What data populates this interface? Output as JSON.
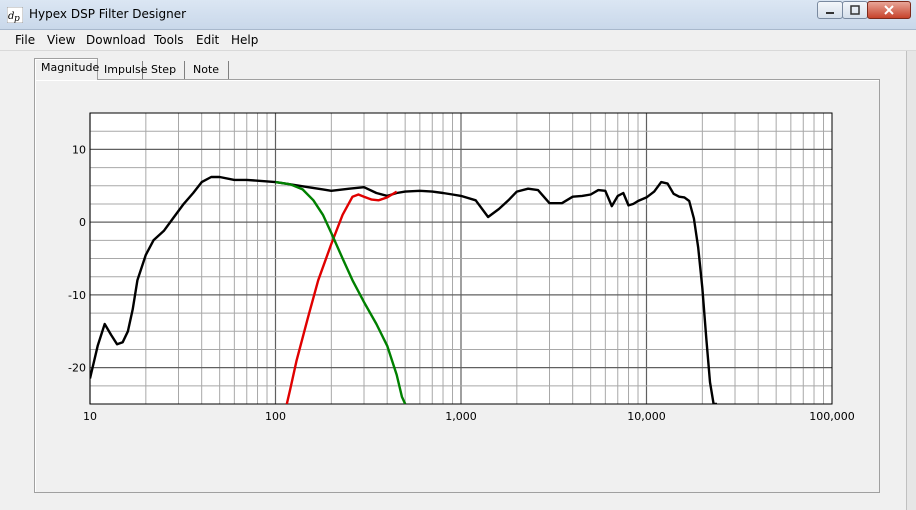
{
  "window": {
    "title": "Hypex DSP Filter Designer"
  },
  "menu": [
    "File",
    "View",
    "Download",
    "Tools",
    "Edit",
    "Help"
  ],
  "tabs": [
    {
      "label": "Magnitude",
      "active": true
    },
    {
      "label": "Impulse",
      "active": false
    },
    {
      "label": "Step",
      "active": false
    },
    {
      "label": "Note",
      "active": false
    }
  ],
  "chart_data": {
    "type": "line",
    "xscale": "log",
    "xlim": [
      10,
      100000
    ],
    "ylim": [
      -25,
      15
    ],
    "grid": true,
    "ytick_labels": [
      "10",
      "0",
      "-10",
      "-20"
    ],
    "ytick_values": [
      10,
      0,
      -10,
      -20
    ],
    "xtick_labels": [
      "10",
      "100",
      "1,000",
      "10,000",
      "100,000"
    ],
    "xtick_values": [
      10,
      100,
      1000,
      10000,
      100000
    ],
    "series": [
      {
        "color": "#000000",
        "x": [
          10,
          11,
          12,
          13,
          14,
          15,
          16,
          17,
          18,
          20,
          22,
          25,
          28,
          32,
          36,
          40,
          45,
          50,
          60,
          70,
          80,
          100,
          120,
          150,
          180,
          200,
          250,
          300,
          350,
          400,
          450,
          500,
          600,
          700,
          800,
          900,
          1000,
          1200,
          1400,
          1600,
          1800,
          2000,
          2300,
          2600,
          3000,
          3500,
          4000,
          4500,
          5000,
          5500,
          6000,
          6500,
          7000,
          7500,
          8000,
          8500,
          9000,
          10000,
          11000,
          12000,
          13000,
          14000,
          15000,
          16000,
          17000,
          18000,
          19000,
          20000,
          21000,
          22000,
          23000,
          24000
        ],
        "y": [
          -21.5,
          -17,
          -14,
          -15.5,
          -16.8,
          -16.5,
          -15,
          -12,
          -8,
          -4.5,
          -2.5,
          -1.2,
          0.5,
          2.5,
          4,
          5.5,
          6.2,
          6.2,
          5.8,
          5.8,
          5.7,
          5.5,
          5.2,
          4.8,
          4.5,
          4.3,
          4.6,
          4.8,
          4,
          3.6,
          4,
          4.2,
          4.3,
          4.2,
          4,
          3.8,
          3.6,
          3,
          0.7,
          1.8,
          3,
          4.2,
          4.6,
          4.4,
          2.6,
          2.6,
          3.5,
          3.6,
          3.8,
          4.4,
          4.3,
          2.2,
          3.6,
          4,
          2.3,
          2.5,
          2.9,
          3.4,
          4.2,
          5.5,
          5.3,
          3.9,
          3.5,
          3.4,
          2.9,
          0.5,
          -3.5,
          -9,
          -16,
          -22,
          -25,
          -25
        ]
      },
      {
        "color": "#e00000",
        "x": [
          115,
          120,
          130,
          150,
          170,
          200,
          230,
          260,
          280,
          300,
          330,
          360,
          400,
          450
        ],
        "y": [
          -25,
          -23,
          -19,
          -13,
          -8,
          -3,
          1,
          3.5,
          3.8,
          3.5,
          3.1,
          3,
          3.4,
          4.2
        ]
      },
      {
        "color": "#008000",
        "x": [
          100,
          120,
          140,
          160,
          180,
          200,
          230,
          260,
          300,
          350,
          400,
          450,
          480,
          500
        ],
        "y": [
          5.5,
          5.2,
          4.5,
          3,
          1,
          -1.5,
          -5,
          -8,
          -11,
          -14,
          -17,
          -21,
          -24,
          -25
        ]
      }
    ]
  }
}
